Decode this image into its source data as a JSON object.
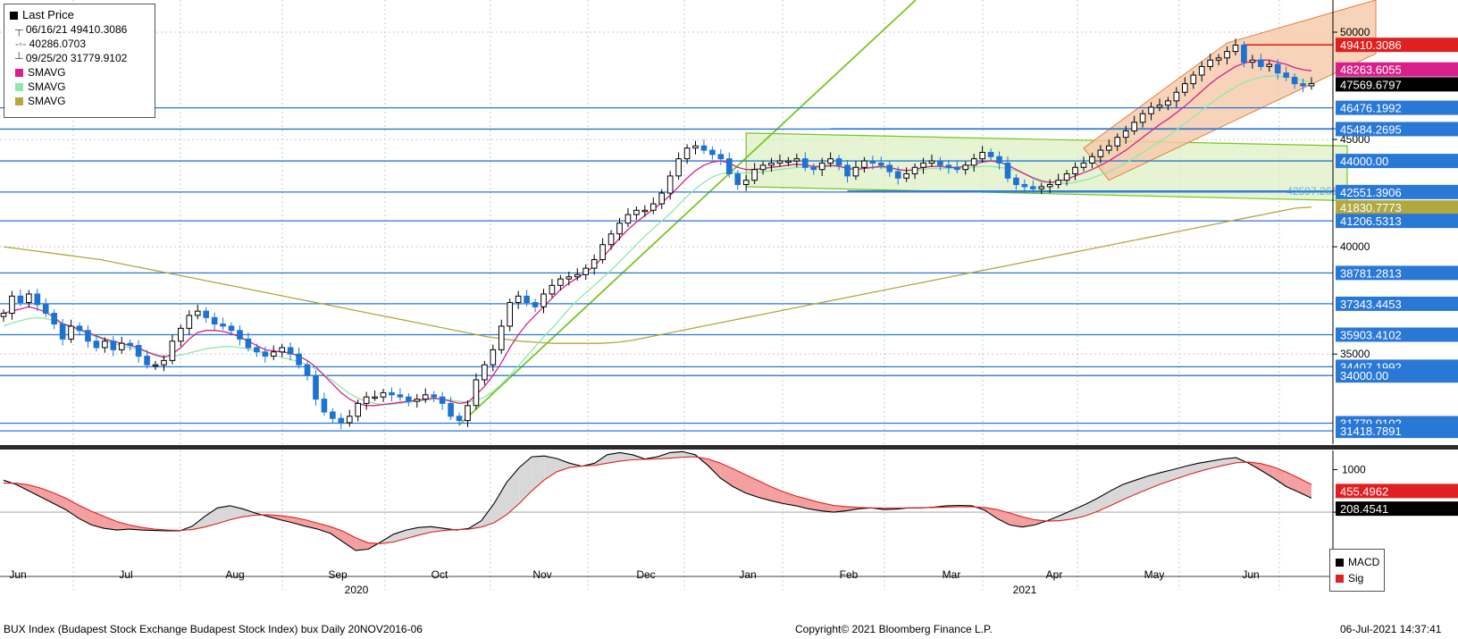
{
  "legend": {
    "title": "Last Price",
    "high": "06/16/21 49410.3086",
    "avg": "40286.0703",
    "low": "09/25/20 31779.9102",
    "sma1": "SMAVG",
    "sma2": "SMAVG",
    "sma3": "SMAVG"
  },
  "macd_legend": {
    "macd": "MACD",
    "sig": "Sig"
  },
  "footer": {
    "left": "BUX Index (Budapest Stock Exchange Budapest Stock Index) bux  Daily 20NOV2016-06",
    "center": "Copyright© 2021 Bloomberg Finance L.P.",
    "right": "06-Jul-2021 14:37:41"
  },
  "colors": {
    "price_up": "#000000",
    "price_down": "#1e73d2",
    "sma_fast": "#d8208a",
    "sma_mid": "#8ee8a8",
    "sma_slow": "#b0a840",
    "trendline": "#7ac520",
    "channel_fill": "#f5c9a8",
    "range_fill": "#dcf0c0",
    "hline": "#2a78d6",
    "resistance": "#e02020",
    "macd": "#000000",
    "signal": "#e02020",
    "macd_fill_up": "#d8d8d8",
    "macd_fill_down": "#f4a0a0"
  },
  "chart_data": [
    {
      "type": "candlestick",
      "title": "BUX Index (Budapest Stock Exchange Budapest Stock Index)",
      "x_months": [
        "Jun",
        "Jul",
        "Aug",
        "Sep",
        "Oct",
        "Nov",
        "Dec",
        "Jan",
        "Feb",
        "Mar",
        "Apr",
        "May",
        "Jun"
      ],
      "x_years": [
        "2020",
        "2021"
      ],
      "ylim": [
        30800,
        51500
      ],
      "y_ticks": [
        35000,
        40000,
        45000,
        50000
      ],
      "series_close": [
        36900,
        37700,
        37400,
        37800,
        37300,
        36900,
        36400,
        35700,
        36300,
        36100,
        35600,
        35300,
        35600,
        35200,
        35500,
        35400,
        34900,
        34500,
        34500,
        34700,
        35600,
        36200,
        36800,
        37000,
        36700,
        36400,
        36300,
        36100,
        35700,
        35300,
        35100,
        34900,
        35100,
        35300,
        35000,
        34500,
        34000,
        32900,
        32300,
        32000,
        31800,
        32100,
        32700,
        33000,
        33000,
        33200,
        33100,
        33000,
        32800,
        32900,
        33100,
        33000,
        32700,
        32100,
        31900,
        32600,
        33800,
        34500,
        35200,
        36300,
        37400,
        37700,
        37400,
        37200,
        37800,
        38200,
        38500,
        38600,
        38700,
        39000,
        39400,
        40100,
        40600,
        41100,
        41500,
        41700,
        41700,
        42000,
        42500,
        43300,
        44100,
        44600,
        44700,
        44500,
        44300,
        44100,
        43400,
        42900,
        43100,
        43600,
        43800,
        43900,
        44000,
        44000,
        44100,
        43700,
        43600,
        43900,
        44100,
        43800,
        43300,
        43700,
        44000,
        43900,
        43800,
        43500,
        43200,
        43400,
        43700,
        43900,
        44000,
        43800,
        43700,
        43600,
        43800,
        44100,
        44400,
        44200,
        43900,
        43200,
        42900,
        42800,
        42700,
        42800,
        42900,
        43100,
        43400,
        43700,
        43900,
        44200,
        44500,
        44700,
        45100,
        45400,
        45800,
        46200,
        46500,
        46600,
        46800,
        47200,
        47600,
        48000,
        48400,
        48700,
        48800,
        49100,
        49400,
        48600,
        48700,
        48400,
        48500,
        48100,
        47900,
        47600,
        47500,
        47600
      ],
      "sma_fast": [
        36900,
        37000,
        37100,
        37200,
        37100,
        36950,
        36700,
        36400,
        36300,
        36150,
        36000,
        35850,
        35700,
        35600,
        35500,
        35400,
        35300,
        35100,
        34950,
        34850,
        35000,
        35300,
        35700,
        36000,
        36100,
        36100,
        36050,
        35950,
        35800,
        35600,
        35400,
        35200,
        35150,
        35100,
        35050,
        34900,
        34700,
        34400,
        34000,
        33600,
        33200,
        32900,
        32700,
        32600,
        32600,
        32650,
        32700,
        32750,
        32800,
        32850,
        32900,
        32950,
        32900,
        32800,
        32700,
        32750,
        33100,
        33500,
        34000,
        34600,
        35300,
        35900,
        36400,
        36800,
        37200,
        37600,
        38000,
        38300,
        38550,
        38800,
        39100,
        39500,
        39950,
        40400,
        40800,
        41150,
        41450,
        41750,
        42050,
        42400,
        42800,
        43200,
        43550,
        43800,
        43950,
        44000,
        43900,
        43700,
        43600,
        43600,
        43650,
        43700,
        43750,
        43800,
        43850,
        43800,
        43750,
        43750,
        43800,
        43750,
        43650,
        43600,
        43650,
        43700,
        43750,
        43700,
        43600,
        43550,
        43600,
        43700,
        43750,
        43750,
        43700,
        43700,
        43750,
        43850,
        43950,
        44000,
        43950,
        43800,
        43600,
        43400,
        43200,
        43050,
        43000,
        43050,
        43150,
        43300,
        43450,
        43600,
        43800,
        44000,
        44250,
        44500,
        44800,
        45100,
        45400,
        45700,
        45950,
        46250,
        46550,
        46900,
        47250,
        47600,
        47900,
        48150,
        48400,
        48550,
        48650,
        48700,
        48700,
        48600,
        48500,
        48350,
        48250,
        48200
      ],
      "sma_mid": [
        36300,
        36450,
        36550,
        36650,
        36700,
        36650,
        36550,
        36400,
        36250,
        36100,
        35950,
        35800,
        35650,
        35500,
        35400,
        35300,
        35200,
        35100,
        35000,
        34900,
        34900,
        34950,
        35050,
        35150,
        35250,
        35300,
        35350,
        35350,
        35300,
        35250,
        35150,
        35050,
        34950,
        34850,
        34750,
        34650,
        34500,
        34300,
        34050,
        33750,
        33450,
        33150,
        32950,
        32800,
        32700,
        32650,
        32650,
        32700,
        32750,
        32800,
        32850,
        32900,
        32900,
        32850,
        32800,
        32750,
        32850,
        33000,
        33250,
        33600,
        34000,
        34450,
        34900,
        35350,
        35800,
        36200,
        36650,
        37100,
        37500,
        37850,
        38200,
        38550,
        38900,
        39300,
        39700,
        40100,
        40500,
        40850,
        41200,
        41550,
        41950,
        42350,
        42700,
        43000,
        43250,
        43400,
        43450,
        43450,
        43450,
        43450,
        43500,
        43550,
        43600,
        43650,
        43700,
        43700,
        43700,
        43700,
        43750,
        43750,
        43700,
        43700,
        43700,
        43700,
        43700,
        43650,
        43600,
        43550,
        43550,
        43600,
        43650,
        43650,
        43650,
        43650,
        43650,
        43700,
        43750,
        43750,
        43700,
        43650,
        43550,
        43400,
        43250,
        43100,
        43000,
        42950,
        42950,
        43000,
        43100,
        43200,
        43350,
        43500,
        43700,
        43900,
        44150,
        44400,
        44650,
        44900,
        45150,
        45450,
        45750,
        46050,
        46350,
        46650,
        46950,
        47200,
        47450,
        47650,
        47800,
        47900,
        47950,
        47950,
        47900,
        47850,
        47750,
        47650
      ],
      "sma_slow": [
        40000,
        39900,
        39800,
        39700,
        39600,
        39500,
        39400,
        39250,
        39100,
        38950,
        38800,
        38650,
        38500,
        38350,
        38200,
        38050,
        37900,
        37750,
        37600,
        37450,
        37300,
        37150,
        37000,
        36850,
        36700,
        36550,
        36400,
        36250,
        36100,
        35950,
        35800,
        35700,
        35600,
        35550,
        35500,
        35500,
        35500,
        35500,
        35550,
        35650,
        35800,
        35950,
        36100,
        36250,
        36400,
        36550,
        36700,
        36850,
        37000,
        37150,
        37300,
        37450,
        37600,
        37750,
        37900,
        38050,
        38200,
        38350,
        38500,
        38650,
        38800,
        38950,
        39100,
        39250,
        39400,
        39550,
        39700,
        39850,
        40000,
        40150,
        40300,
        40450,
        40600,
        40750,
        40900,
        41050,
        41200,
        41350,
        41500,
        41650,
        41800,
        41850
      ],
      "horizontal_levels": [
        46476.1992,
        45484.2695,
        44000.0,
        42551.3906,
        41206.5313,
        38781.2813,
        37343.4453,
        35903.4102,
        34407.1992,
        34000.0,
        31779.9102,
        31418.7891
      ],
      "value_labels": [
        {
          "value": 49410.3086,
          "label": "49410.3086",
          "color": "#e02020"
        },
        {
          "value": 48263.6055,
          "label": "48263.6055",
          "color": "#d8208a"
        },
        {
          "value": 47569.6797,
          "label": "47569.6797",
          "color": "#000000"
        },
        {
          "value": 46476.1992,
          "label": "46476.1992",
          "color": "#2a78d6"
        },
        {
          "value": 45484.2695,
          "label": "45484.2695",
          "color": "#2a78d6"
        },
        {
          "value": 44000.0,
          "label": "44000.00",
          "color": "#2a78d6"
        },
        {
          "value": 42551.3906,
          "label": "42551.3906",
          "color": "#2a78d6"
        },
        {
          "value": 41830.7773,
          "label": "41830.7773",
          "color": "#b0a840"
        },
        {
          "value": 41206.5313,
          "label": "41206.5313",
          "color": "#2a78d6"
        },
        {
          "value": 38781.2813,
          "label": "38781.2813",
          "color": "#2a78d6"
        },
        {
          "value": 37343.4453,
          "label": "37343.4453",
          "color": "#2a78d6"
        },
        {
          "value": 35903.4102,
          "label": "35903.4102",
          "color": "#2a78d6"
        },
        {
          "value": 34407.1992,
          "label": "34407.1992",
          "color": "#2a78d6"
        },
        {
          "value": 34000.0,
          "label": "34000.00",
          "color": "#2a78d6"
        },
        {
          "value": 31779.9102,
          "label": "31779.9102",
          "color": "#2a78d6"
        },
        {
          "value": 31418.7891,
          "label": "31418.7891",
          "color": "#2a78d6"
        }
      ],
      "annotation": "42597.261"
    },
    {
      "type": "line",
      "title": "MACD",
      "ylim": [
        -1300,
        1450
      ],
      "y_ticks": [
        -1000,
        0,
        1000
      ],
      "series": [
        {
          "name": "MACD",
          "values": [
            750,
            650,
            500,
            350,
            200,
            50,
            -150,
            -300,
            -380,
            -420,
            -400,
            -420,
            -430,
            -440,
            -440,
            -330,
            -100,
            100,
            150,
            80,
            -20,
            -100,
            -180,
            -250,
            -330,
            -400,
            -500,
            -700,
            -900,
            -870,
            -700,
            -520,
            -420,
            -360,
            -340,
            -380,
            -420,
            -380,
            -200,
            200,
            700,
            1050,
            1300,
            1320,
            1260,
            1150,
            1080,
            1150,
            1350,
            1400,
            1350,
            1250,
            1300,
            1400,
            1420,
            1350,
            1100,
            800,
            600,
            450,
            350,
            270,
            200,
            150,
            80,
            30,
            0,
            30,
            80,
            100,
            60,
            70,
            100,
            100,
            120,
            150,
            160,
            150,
            50,
            -150,
            -300,
            -350,
            -300,
            -200,
            -80,
            50,
            180,
            330,
            500,
            650,
            750,
            850,
            930,
            1000,
            1080,
            1150,
            1200,
            1250,
            1280,
            1150,
            980,
            800,
            600,
            470,
            330
          ]
        },
        {
          "name": "Sig",
          "values": [
            680,
            680,
            640,
            560,
            450,
            320,
            160,
            20,
            -100,
            -220,
            -300,
            -360,
            -400,
            -420,
            -430,
            -410,
            -350,
            -270,
            -180,
            -110,
            -70,
            -60,
            -80,
            -120,
            -180,
            -260,
            -340,
            -450,
            -600,
            -720,
            -740,
            -700,
            -620,
            -540,
            -470,
            -430,
            -410,
            -400,
            -350,
            -250,
            -60,
            200,
            500,
            760,
            950,
            1050,
            1080,
            1100,
            1150,
            1200,
            1230,
            1240,
            1250,
            1270,
            1290,
            1300,
            1250,
            1150,
            1020,
            880,
            740,
            600,
            480,
            380,
            300,
            220,
            160,
            130,
            110,
            100,
            95,
            95,
            100,
            105,
            110,
            120,
            125,
            125,
            110,
            60,
            -20,
            -110,
            -180,
            -210,
            -200,
            -160,
            -90,
            20,
            150,
            290,
            420,
            540,
            660,
            760,
            860,
            950,
            1030,
            1100,
            1160,
            1180,
            1140,
            1060,
            940,
            800,
            650
          ]
        }
      ],
      "value_labels": [
        {
          "value": 455.4962,
          "label": "455.4962",
          "color": "#e02020"
        },
        {
          "value": 208.4541,
          "label": "208.4541",
          "color": "#000000"
        }
      ]
    }
  ]
}
